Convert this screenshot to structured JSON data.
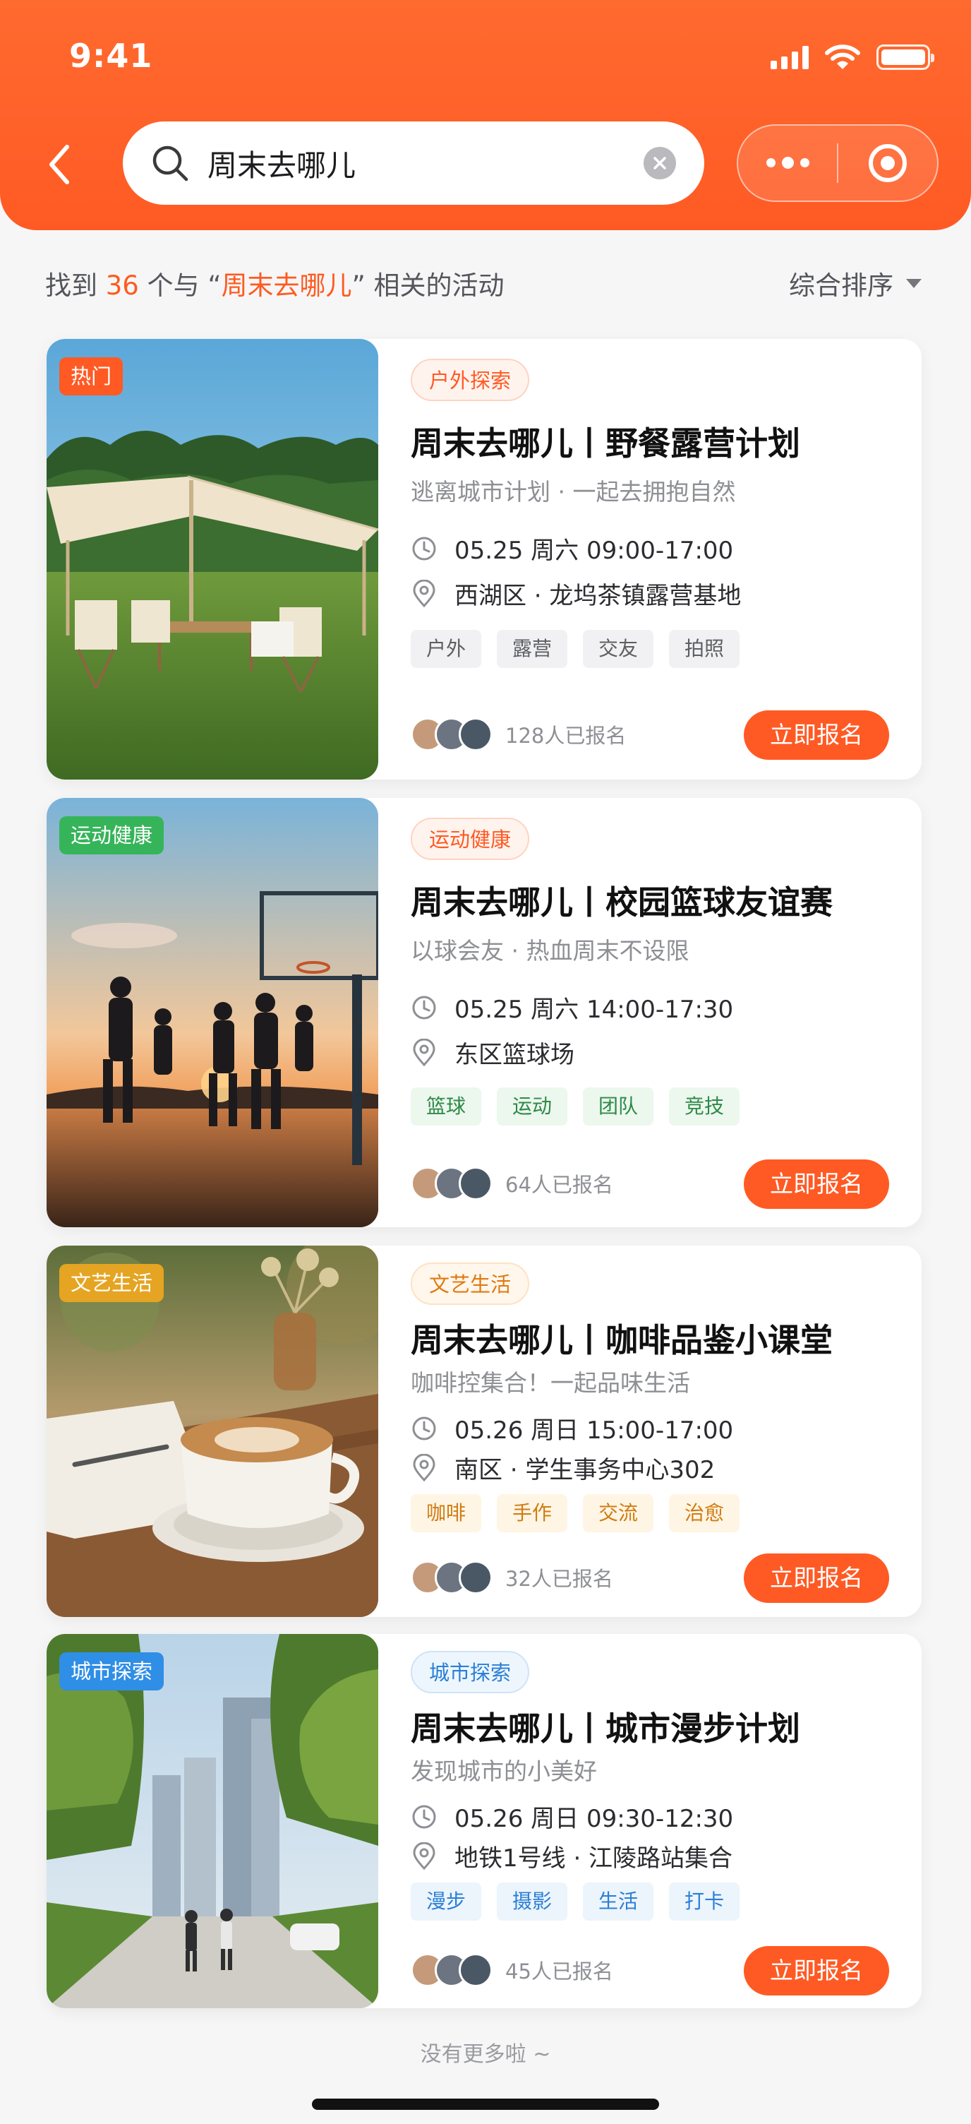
{
  "status_bar": {
    "time": "9:41"
  },
  "search": {
    "query": "周末去哪儿"
  },
  "summary": {
    "prefix": "找到 ",
    "count": "36",
    "middle": " 个与 “",
    "keyword": "周末去哪儿",
    "suffix": "” 相关的活动"
  },
  "sort": {
    "label": "综合排序"
  },
  "colors": {
    "brand": "#ff5a24",
    "badge_hot": "#ff5a24",
    "badge_sport": "#36b45a",
    "badge_culture": "#e5a422",
    "badge_city": "#2f8ee6"
  },
  "cards": [
    {
      "badge": "热门",
      "category": "户外探索",
      "title": "周末去哪儿丨野餐露营计划",
      "subtitle": "逃离城市计划 · 一起去拥抱自然",
      "datetime": "05.25 周六 09:00-17:00",
      "location": "西湖区 · 龙坞茶镇露营基地",
      "tags": [
        "户外",
        "露营",
        "交友",
        "拍照"
      ],
      "signed_up": "128人已报名",
      "button": "立即报名",
      "image_icon": "camping-tent-photo"
    },
    {
      "badge": "运动健康",
      "category": "运动健康",
      "title": "周末去哪儿丨校园篮球友谊赛",
      "subtitle": "以球会友 · 热血周末不设限",
      "datetime": "05.25 周六 14:00-17:30",
      "location": "东区篮球场",
      "tags": [
        "篮球",
        "运动",
        "团队",
        "竞技"
      ],
      "signed_up": "64人已报名",
      "button": "立即报名",
      "image_icon": "basketball-sunset-photo"
    },
    {
      "badge": "文艺生活",
      "category": "文艺生活",
      "title": "周末去哪儿丨咖啡品鉴小课堂",
      "subtitle": "咖啡控集合！一起品味生活",
      "datetime": "05.26 周日 15:00-17:00",
      "location": "南区 · 学生事务中心302",
      "tags": [
        "咖啡",
        "手作",
        "交流",
        "治愈"
      ],
      "signed_up": "32人已报名",
      "button": "立即报名",
      "image_icon": "latte-art-photo"
    },
    {
      "badge": "城市探索",
      "category": "城市探索",
      "title": "周末去哪儿丨城市漫步计划",
      "subtitle": "发现城市的小美好",
      "datetime": "05.26 周日 09:30-12:30",
      "location": "地铁1号线 · 江陵路站集合",
      "tags": [
        "漫步",
        "摄影",
        "生活",
        "打卡"
      ],
      "signed_up": "45人已报名",
      "button": "立即报名",
      "image_icon": "city-walk-photo"
    }
  ],
  "footer": {
    "text": "没有更多啦 ~"
  }
}
